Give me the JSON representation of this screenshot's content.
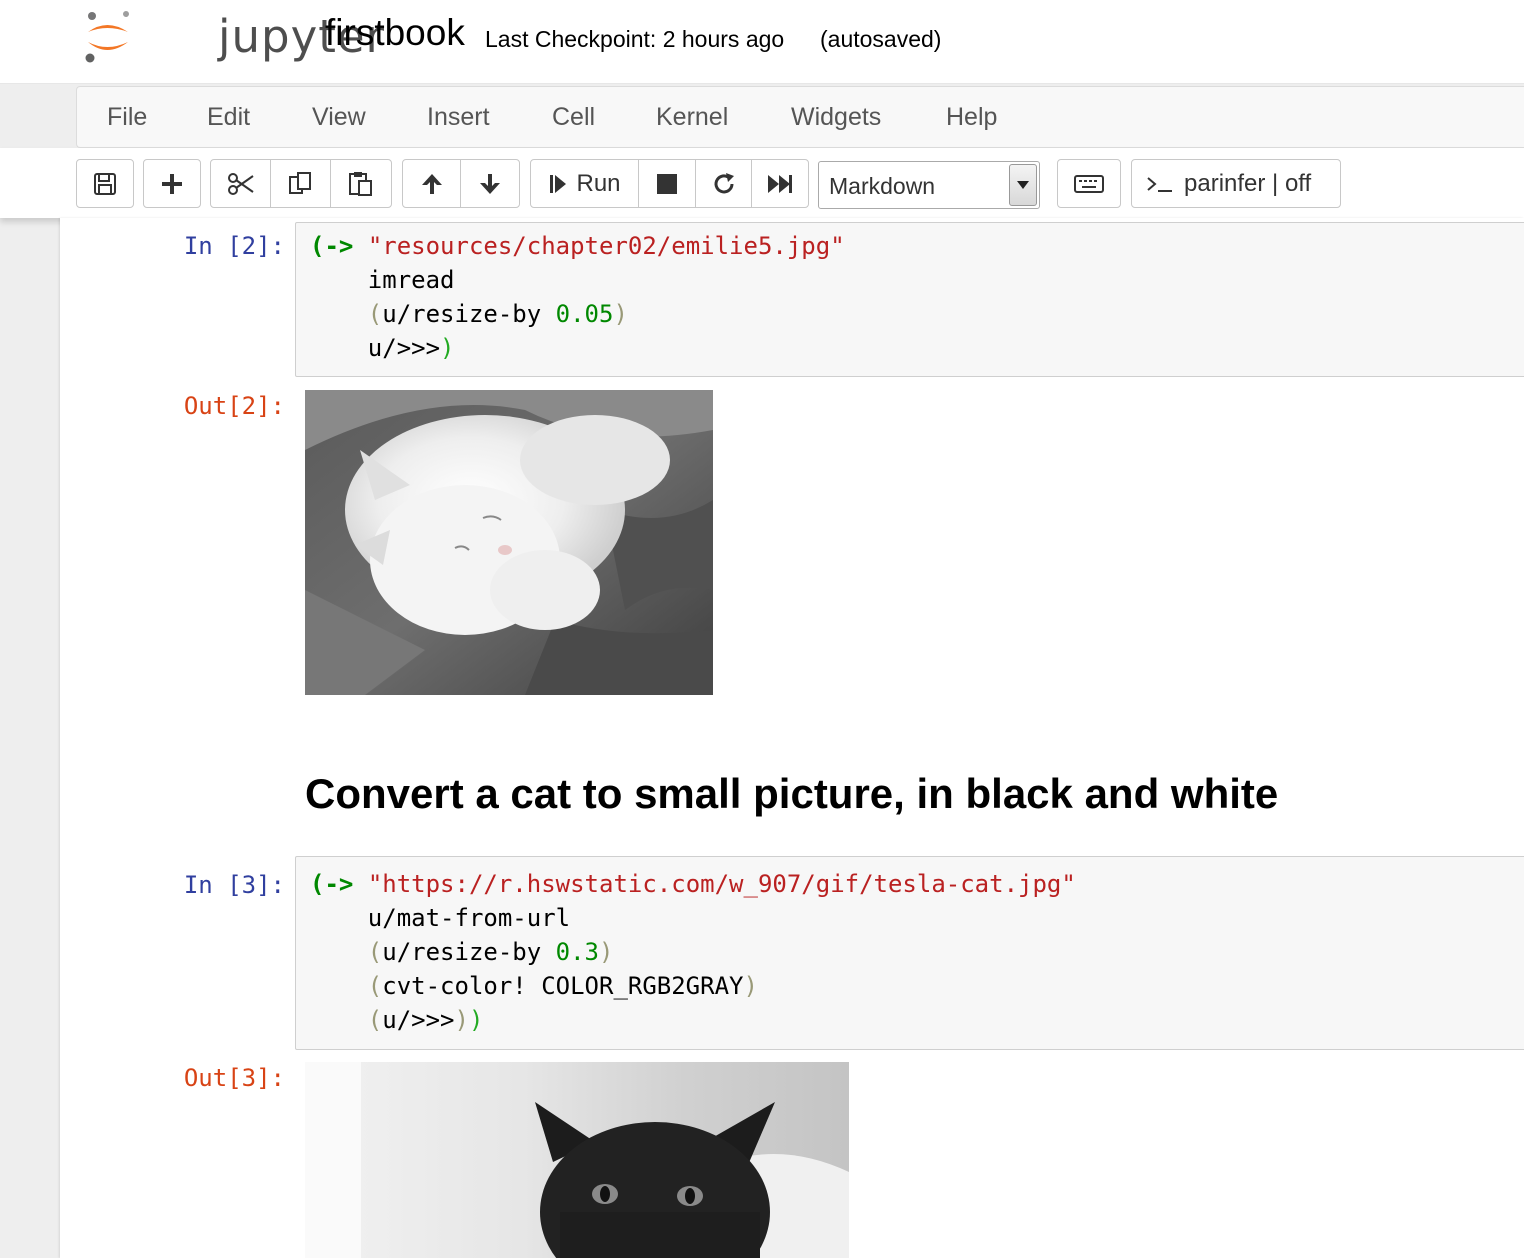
{
  "header": {
    "logo_text": "jupyter",
    "notebook_title": "firstbook",
    "checkpoint": "Last Checkpoint: 2 hours ago",
    "autosave": "(autosaved)"
  },
  "menu": [
    "File",
    "Edit",
    "View",
    "Insert",
    "Cell",
    "Kernel",
    "Widgets",
    "Help"
  ],
  "toolbar": {
    "run_label": "Run",
    "cell_type": "Markdown",
    "parinfer_label": "parinfer | off",
    "icons": [
      "save-icon",
      "plus-icon",
      "scissors-icon",
      "copy-icon",
      "paste-icon",
      "arrow-up-icon",
      "arrow-down-icon",
      "step-icon",
      "stop-icon",
      "restart-icon",
      "fast-forward-icon",
      "keyboard-icon",
      "terminal-icon"
    ]
  },
  "cells": {
    "cell2": {
      "in_prompt": "In [2]:",
      "out_prompt": "Out[2]:",
      "lines": [
        {
          "open": "(->",
          "str": "\"resources/chapter02/emilie5.jpg\""
        },
        {
          "text": "imread"
        },
        {
          "open": "(",
          "text": "u/resize-by ",
          "num": "0.05",
          "close": ")"
        },
        {
          "text": "u/>>>",
          "close": ")"
        }
      ],
      "image_label": "white cat photo"
    },
    "markdown_heading": "Convert a cat to small picture, in black and white",
    "cell3": {
      "in_prompt": "In [3]:",
      "out_prompt": "Out[3]:",
      "lines": [
        {
          "open": "(->",
          "str": "\"https://r.hswstatic.com/w_907/gif/tesla-cat.jpg\""
        },
        {
          "text": "u/mat-from-url"
        },
        {
          "open": "(",
          "text": "u/resize-by ",
          "num": "0.3",
          "close": ")"
        },
        {
          "open": "(",
          "text": "cvt-color! COLOR_RGB2GRAY",
          "close": ")"
        },
        {
          "open": "(",
          "text": "u/>>>",
          "close": ")",
          "close2": ")"
        }
      ],
      "image_label": "black cat grayscale photo"
    }
  },
  "colors": {
    "in_prompt": "#303f9f",
    "out_prompt": "#d84315",
    "string": "#ba2121",
    "number": "#008800",
    "logo_orange": "#f37726"
  }
}
